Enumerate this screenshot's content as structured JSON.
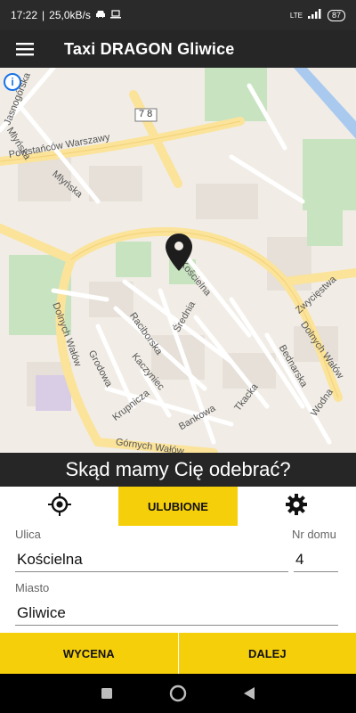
{
  "status_bar": {
    "time": "17:22",
    "speed": "25,0kB/s",
    "network": "LTE",
    "battery": "87",
    "icons": [
      "car-icon",
      "laptop-icon",
      "signal-icon",
      "battery-icon"
    ]
  },
  "app_bar": {
    "menu_icon": "hamburger-icon",
    "title": "Taxi DRAGON Gliwice"
  },
  "map": {
    "street_labels": [
      "Jasnogórska",
      "Mlyńska",
      "Powstańców Warszawy",
      "Mlyńska",
      "Kościelna",
      "Średnia",
      "Raciborska",
      "Grodowa",
      "Kaczyniec",
      "Krupnicza",
      "Bankowa",
      "Tkacka",
      "Bednarska",
      "Zwycięstwa",
      "Dolnych Wałów",
      "Dolnych Wałów",
      "Wodna",
      "Górnych Wałów",
      "Górnych"
    ],
    "road_number": "78",
    "pin_icon": "map-pin-icon",
    "info_icon": "info-icon"
  },
  "prompt": "Skąd mamy Cię odebrać?",
  "tabs": {
    "location_icon": "crosshair-location-icon",
    "favorites_label": "ULUBIONE",
    "settings_icon": "gear-icon"
  },
  "form": {
    "street_label": "Ulica",
    "street_value": "Kościelna",
    "house_label": "Nr domu",
    "house_value": "4",
    "city_label": "Miasto",
    "city_value": "Gliwice"
  },
  "actions": {
    "quote_label": "WYCENA",
    "next_label": "DALEJ"
  },
  "nav_bar": {
    "recent_icon": "square-icon",
    "home_icon": "circle-icon",
    "back_icon": "triangle-back-icon"
  },
  "colors": {
    "accent": "#f6cf0b",
    "dark": "#262626",
    "map_road": "#fbe39a",
    "map_park": "#c8e3c0"
  }
}
